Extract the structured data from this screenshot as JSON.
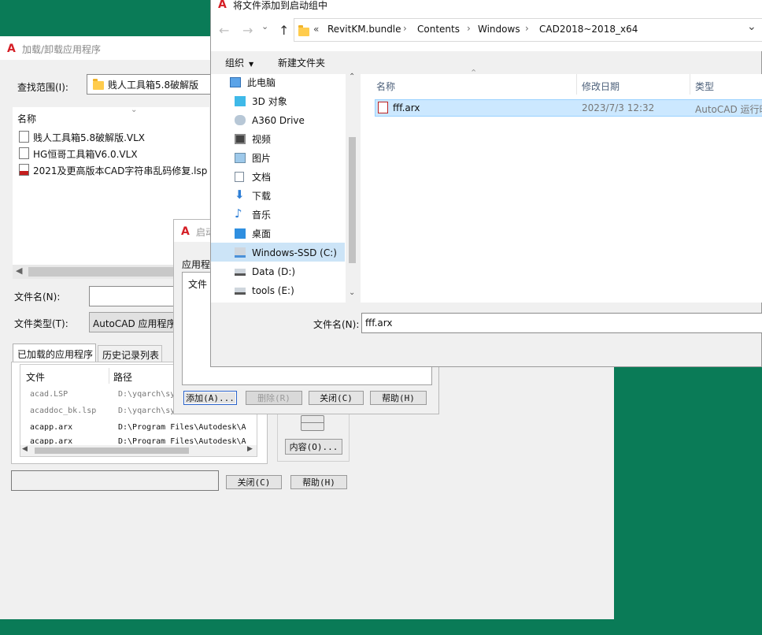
{
  "load_dialog": {
    "title": "加载/卸载应用程序",
    "lookin_label": "查找范围(I):",
    "lookin_value": "贱人工具箱5.8破解版",
    "name_header": "名称",
    "files": [
      "贱人工具箱5.8破解版.VLX",
      "HG恒哥工具箱V6.0.VLX",
      "2021及更高版本CAD字符串乱码修复.lsp"
    ],
    "filename_label": "文件名(N):",
    "filetype_label": "文件类型(T):",
    "filetype_value": "AutoCAD 应用程序",
    "tab_loaded": "已加载的应用程序",
    "tab_history": "历史记录列表",
    "col_file": "文件",
    "col_path": "路径",
    "loaded_rows": [
      {
        "file": "acad.LSP",
        "path": "D:\\yqarch\\sy"
      },
      {
        "file": "acaddoc_bk.lsp",
        "path": "D:\\yqarch\\sy"
      },
      {
        "file": "acapp.arx",
        "path": "D:\\Program Files\\Autodesk\\A"
      },
      {
        "file": "acapp.arx",
        "path": "D:\\Program Files\\Autodesk\\A"
      }
    ],
    "contents_button": "内容(O)...",
    "close_button": "关闭(C)",
    "help_button": "帮助(H)"
  },
  "startup_dialog": {
    "title": "启动",
    "app_label": "应用程",
    "file_col": "文件",
    "add_button": "添加(A)...",
    "delete_button": "删除(R)",
    "close_button": "关闭(C)",
    "help_button": "帮助(H)"
  },
  "file_dialog": {
    "title": "将文件添加到启动组中",
    "breadcrumb": [
      "RevitKM.bundle",
      "Contents",
      "Windows",
      "CAD2018~2018_x64"
    ],
    "organize": "组织",
    "new_folder": "新建文件夹",
    "nav": [
      {
        "label": "此电脑",
        "icon": "computer-icon"
      },
      {
        "label": "3D 对象",
        "icon": "cube-icon"
      },
      {
        "label": "A360 Drive",
        "icon": "cloud-drive-icon"
      },
      {
        "label": "视频",
        "icon": "video-icon"
      },
      {
        "label": "图片",
        "icon": "picture-icon"
      },
      {
        "label": "文档",
        "icon": "document-icon"
      },
      {
        "label": "下载",
        "icon": "download-icon"
      },
      {
        "label": "音乐",
        "icon": "music-icon"
      },
      {
        "label": "桌面",
        "icon": "desktop-icon"
      },
      {
        "label": "Windows-SSD (C:)",
        "icon": "windows-drive-icon"
      },
      {
        "label": "Data (D:)",
        "icon": "drive-icon"
      },
      {
        "label": "tools (E:)",
        "icon": "drive-icon"
      }
    ],
    "col_name": "名称",
    "col_date": "修改日期",
    "col_type": "类型",
    "file": {
      "name": "fff.arx",
      "date": "2023/7/3 12:32",
      "type": "AutoCAD 运行时"
    },
    "filename_label": "文件名(N):",
    "filename_value": "fff.arx"
  }
}
